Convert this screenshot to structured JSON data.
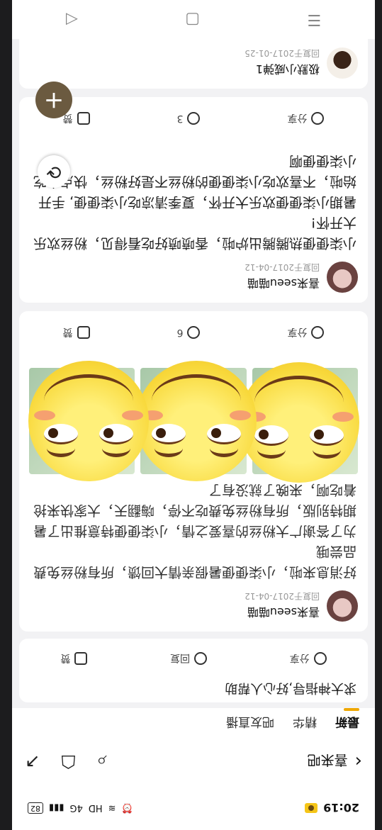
{
  "status_bar": {
    "time": "20:19",
    "network": "4G",
    "hd": "HD",
    "battery": "82"
  },
  "header": {
    "back_icon": "chevron-left-icon",
    "title": "喜来吧",
    "search_icon": "search-icon",
    "bag_icon": "bag-icon",
    "share_icon": "share-icon"
  },
  "tabs": [
    "最新",
    "精华",
    "吧友直播"
  ],
  "posts": [
    {
      "title": "求大神指导,好心人帮助",
      "actions": {
        "share": "分享",
        "reply": "回复",
        "like": "赞"
      }
    },
    {
      "user": "喜来seeu喵喵",
      "date": "回复于2017-04-12",
      "text": "好消息来啦，小柒便便暑假亲情大回馈，所有粉丝免费品尝哦\n为了答谢广大粉丝的喜爱之情，小柒便便特意推出了暑期特别版，所有粉丝免费吃不停，嗨翻天，大家快来抢着吃啊，来晚了就没有了",
      "actions": {
        "share": "分享",
        "reply": "6",
        "like": "赞"
      }
    },
    {
      "user": "喜来seeu喵喵",
      "date": "回复于2017-04-12",
      "text": "小柒便便热腾腾出炉啦，香喷喷好吃看得见，粉丝欢乐大开怀!\n暑期小柒便便欢乐大开怀，夏季清凉吃小柒便便, 手开始啦，不喜欢吃小柒便便的粉丝不是好粉丝，快点来吃小柒便便啊",
      "actions": {
        "share": "分享",
        "reply": "3",
        "like": "赞"
      }
    },
    {
      "user": "极默小威弹1",
      "date": "回复于2017-01-25"
    }
  ],
  "fab_label": "+",
  "refresh_icon": "refresh-icon",
  "nav": {
    "menu_icon": "menu-icon",
    "home_icon": "home-icon",
    "back_icon": "back-triangle-icon"
  }
}
